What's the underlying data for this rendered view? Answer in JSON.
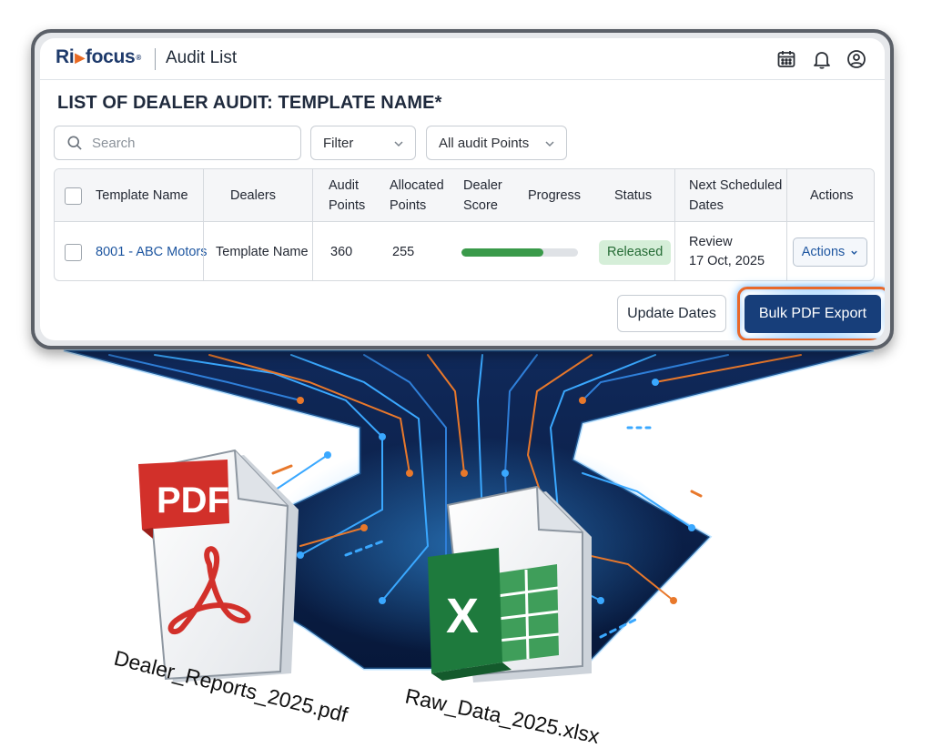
{
  "app": {
    "logo_text_left": "Ri",
    "logo_text_right": "focus",
    "logo_mark": "®",
    "page_name": "Audit List",
    "icons": [
      "calendar-icon",
      "bell-icon",
      "user-circle-icon"
    ]
  },
  "page": {
    "heading": "LIST OF DEALER AUDIT: TEMPLATE NAME*"
  },
  "search": {
    "placeholder": "Search",
    "value": ""
  },
  "filters": {
    "filter_label": "Filter",
    "points_label": "All audit Points"
  },
  "table": {
    "columns": {
      "template_name": "Template Name",
      "dealers": "Dealers",
      "audit_points_1": "Audit",
      "audit_points_2": "Points",
      "allocated_points_1": "Allocated",
      "allocated_points_2": "Points",
      "dealer_score_1": "Dealer",
      "dealer_score_2": "Score",
      "progress": "Progress",
      "status": "Status",
      "next_scheduled_1": "Next Scheduled",
      "next_scheduled_2": "Dates",
      "actions": "Actions"
    },
    "rows": [
      {
        "template_name": "8001 - ABC Motors",
        "dealers": "Template Name",
        "audit_points": "360",
        "allocated_points": "255",
        "progress_fraction": 0.7,
        "status": "Released",
        "next_scheduled_line1": "Review",
        "next_scheduled_line2": "17 Oct, 2025",
        "actions_label": "Actions"
      }
    ]
  },
  "buttons": {
    "update_dates": "Update Dates",
    "bulk_pdf_export": "Bulk PDF Export"
  },
  "illustration": {
    "pdf_badge": "PDF",
    "pdf_filename": "Dealer_Reports_2025.pdf",
    "excel_letter": "X",
    "xlsx_filename": "Raw_Data_2025.xlsx",
    "colors": {
      "brand_navy": "#173e7a",
      "brand_orange": "#e8682b",
      "status_green": "#3a9a4a",
      "pdf_red": "#d2302a",
      "excel_green": "#1e7a3d",
      "circuit_dark": "#0b1f45",
      "circuit_glow": "#3aa8ff"
    }
  }
}
